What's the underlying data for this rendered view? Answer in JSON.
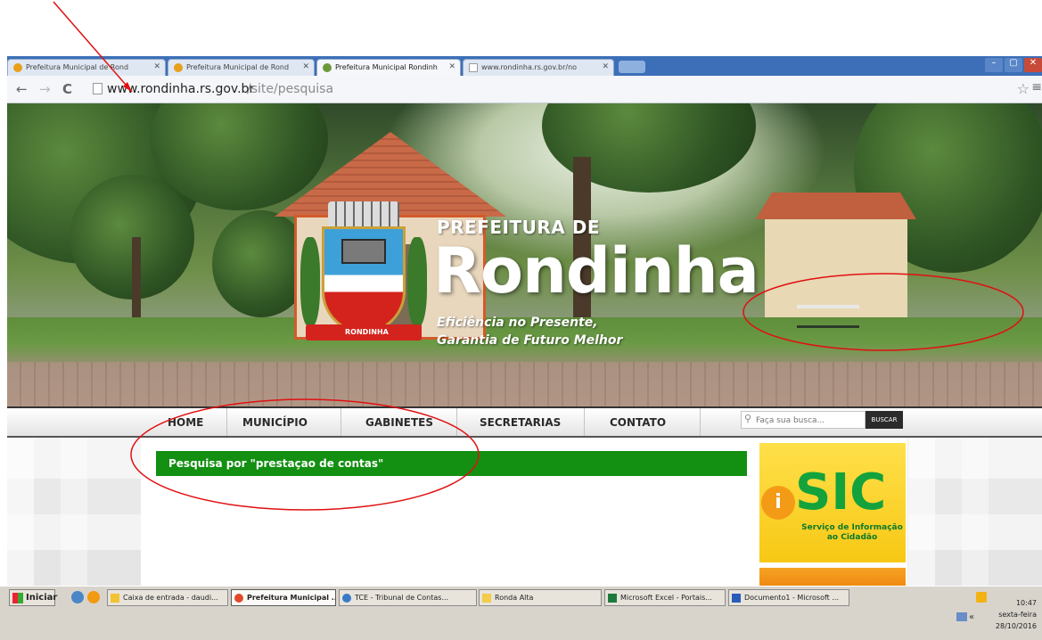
{
  "browser": {
    "tabs": [
      {
        "label": "Prefeitura Municipal de Rond",
        "active": false
      },
      {
        "label": "Prefeitura Municipal de Rond",
        "active": false
      },
      {
        "label": "Prefeitura Municipal Rondinh",
        "active": true
      },
      {
        "label": "www.rondinha.rs.gov.br/no",
        "active": false
      }
    ],
    "url_host": "www.rondinha.rs.gov.br",
    "url_path": "/site/pesquisa"
  },
  "banner": {
    "pre_title": "PREFEITURA DE",
    "title": "Rondinha",
    "slogan_line1": "Eficiência no Presente,",
    "slogan_line2": "Garantia de Futuro Melhor",
    "crest_ribbon": "RONDINHA"
  },
  "nav": {
    "items": [
      "HOME",
      "MUNICÍPIO",
      "GABINETES",
      "SECRETARIAS",
      "CONTATO"
    ],
    "search_placeholder": "Faça sua busca...",
    "search_button": "BUSCAR"
  },
  "content": {
    "search_heading": "Pesquisa por \"prestaçao de contas\""
  },
  "sidebar": {
    "sic_letter": "i",
    "sic_title": "SIC",
    "sic_subtitle_line1": "Serviço de Informação",
    "sic_subtitle_line2": "ao Cidadão"
  },
  "taskbar": {
    "start_label": "Iniciar",
    "tasks": [
      {
        "label": "Caixa de entrada - daudi...",
        "active": false
      },
      {
        "label": "Prefeitura Municipal ...",
        "active": true
      },
      {
        "label": "TCE - Tribunal de Contas...",
        "active": false
      },
      {
        "label": "Ronda Alta",
        "active": false
      },
      {
        "label": "Microsoft Excel - Portais...",
        "active": false
      },
      {
        "label": "Documento1 - Microsoft ...",
        "active": false
      }
    ],
    "clock_time": "10:47",
    "clock_day": "sexta-feira",
    "clock_date": "28/10/2016"
  },
  "colors": {
    "green_bar": "#138f12",
    "annotation_red": "#e01010",
    "sic_green": "#13a23c",
    "sic_yellow": "#f7c815"
  }
}
